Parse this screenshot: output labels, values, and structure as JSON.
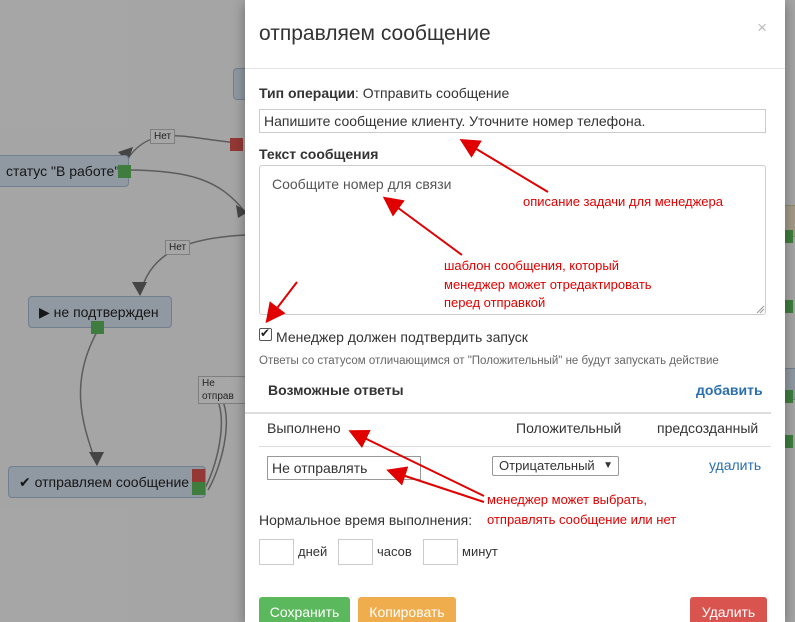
{
  "background": {
    "nodes": [
      {
        "label": "статус \"В работе\""
      },
      {
        "label": "не подтвержден"
      },
      {
        "label": "отправляем сообщение"
      }
    ],
    "edge_labels": [
      "Нет",
      "Нет",
      "Не отправ"
    ]
  },
  "modal": {
    "title": "отправляем сообщение",
    "close": "×",
    "operation_type": {
      "label": "Тип операции",
      "value": ": Отправить сообщение"
    },
    "task_input_value": "Напишите сообщение клиенту. Уточните номер телефона.",
    "message_text": {
      "label": "Текст сообщения",
      "value": "Сообщите номер для связи"
    },
    "confirm_checkbox": {
      "label": "Менеджер должен подтвердить запуск",
      "checked": true
    },
    "hint": "Ответы со статусом отличающимся от \"Положительный\" не будут запускать действие",
    "answers": {
      "title": "Возможные ответы",
      "add_label": "добавить",
      "rows": [
        {
          "name": "Выполнено",
          "status": "Положительный",
          "action": "предсозданный"
        },
        {
          "name": "Не отправлять",
          "status": "Отрицательный",
          "action": "удалить"
        }
      ]
    },
    "normal_time": {
      "label": "Нормальное время выполнения:",
      "days": "дней",
      "hours": "часов",
      "minutes": "минут"
    },
    "buttons": {
      "save": "Сохранить",
      "copy": "Копировать",
      "delete": "Удалить"
    }
  },
  "annotations": {
    "task_desc": "описание задачи для менеджера",
    "template_line1": "шаблон сообщения, который",
    "template_line2": "менеджер может отредактировать",
    "template_line3": "перед отправкой",
    "choice_line1": "менеджер может выбрать,",
    "choice_line2": "отправлять сообщение или нет"
  },
  "colors": {
    "save": "#5cb85c",
    "copy": "#f0ad4e",
    "delete": "#d9534f",
    "link": "#2a6fb0",
    "annotation": "#e00000",
    "node_fill": "#d5e1ee"
  }
}
